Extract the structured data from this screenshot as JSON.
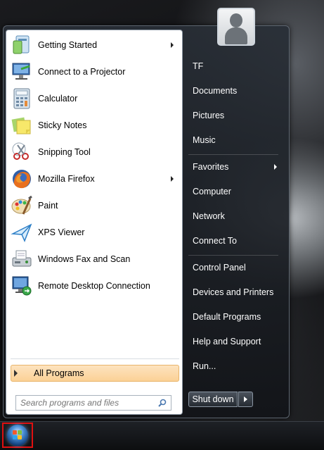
{
  "programs": [
    {
      "label": "Getting Started",
      "icon": "getting-started-icon",
      "submenu": true
    },
    {
      "label": "Connect to a Projector",
      "icon": "projector-icon",
      "submenu": false
    },
    {
      "label": "Calculator",
      "icon": "calculator-icon",
      "submenu": false
    },
    {
      "label": "Sticky Notes",
      "icon": "sticky-notes-icon",
      "submenu": false
    },
    {
      "label": "Snipping Tool",
      "icon": "snipping-tool-icon",
      "submenu": false
    },
    {
      "label": "Mozilla Firefox",
      "icon": "firefox-icon",
      "submenu": true
    },
    {
      "label": "Paint",
      "icon": "paint-icon",
      "submenu": false
    },
    {
      "label": "XPS Viewer",
      "icon": "xps-viewer-icon",
      "submenu": false
    },
    {
      "label": "Windows Fax and Scan",
      "icon": "fax-scan-icon",
      "submenu": false
    },
    {
      "label": "Remote Desktop Connection",
      "icon": "remote-desktop-icon",
      "submenu": false
    }
  ],
  "all_programs_label": "All Programs",
  "search": {
    "placeholder": "Search programs and files"
  },
  "right_items": [
    {
      "label": "TF",
      "submenu": false
    },
    {
      "label": "Documents",
      "submenu": false
    },
    {
      "label": "Pictures",
      "submenu": false
    },
    {
      "label": "Music",
      "submenu": false
    },
    {
      "label": "Favorites",
      "submenu": true
    },
    {
      "label": "Computer",
      "submenu": false
    },
    {
      "label": "Network",
      "submenu": false
    },
    {
      "label": "Connect To",
      "submenu": false
    },
    {
      "label": "Control Panel",
      "submenu": false
    },
    {
      "label": "Devices and Printers",
      "submenu": false
    },
    {
      "label": "Default Programs",
      "submenu": false
    },
    {
      "label": "Help and Support",
      "submenu": false
    },
    {
      "label": "Run...",
      "submenu": false
    }
  ],
  "shutdown_label": "Shut down",
  "colors": {
    "highlight": "#fbd196",
    "start_orb_border": "#e01010"
  }
}
